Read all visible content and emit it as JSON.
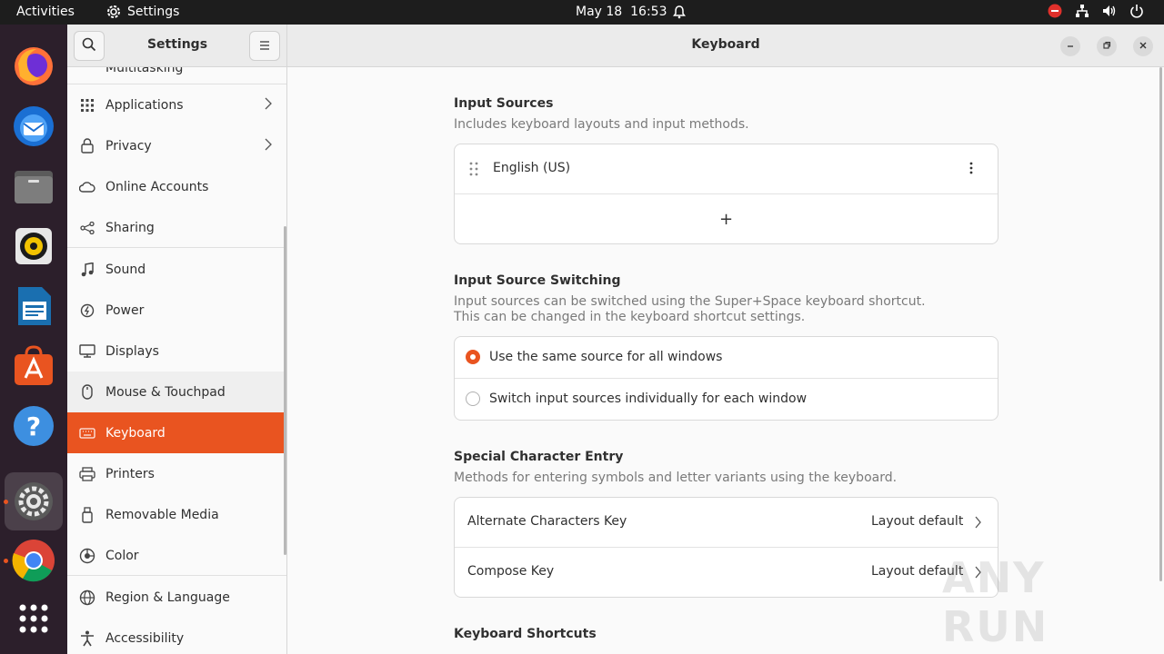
{
  "topbar": {
    "activities": "Activities",
    "app_name": "Settings",
    "date": "May 18",
    "time": "16:53"
  },
  "dock": {
    "items": [
      "firefox-icon",
      "thunderbird-icon",
      "files-icon",
      "rhythmbox-icon",
      "writer-icon",
      "app-center-icon",
      "help-icon",
      "settings-icon",
      "chrome-icon",
      "app-grid-icon"
    ]
  },
  "sidebar": {
    "title": "Settings",
    "partial_top": "Multitasking",
    "items": [
      {
        "label": "Applications",
        "icon": "apps-grid-icon"
      },
      {
        "label": "Privacy",
        "icon": "lock-icon"
      },
      {
        "label": "Online Accounts",
        "icon": "cloud-icon"
      },
      {
        "label": "Sharing",
        "icon": "share-icon"
      },
      {
        "label": "Sound",
        "icon": "music-note-icon"
      },
      {
        "label": "Power",
        "icon": "power-icon"
      },
      {
        "label": "Displays",
        "icon": "display-icon"
      },
      {
        "label": "Mouse & Touchpad",
        "icon": "mouse-icon"
      },
      {
        "label": "Keyboard",
        "icon": "keyboard-icon"
      },
      {
        "label": "Printers",
        "icon": "printer-icon"
      },
      {
        "label": "Removable Media",
        "icon": "usb-icon"
      },
      {
        "label": "Color",
        "icon": "color-icon"
      },
      {
        "label": "Region & Language",
        "icon": "globe-icon"
      },
      {
        "label": "Accessibility",
        "icon": "accessibility-icon"
      }
    ]
  },
  "window": {
    "title": "Keyboard"
  },
  "input_sources": {
    "title": "Input Sources",
    "description": "Includes keyboard layouts and input methods.",
    "sources": [
      "English (US)"
    ],
    "add_symbol": "+"
  },
  "switching": {
    "title": "Input Source Switching",
    "description_1": "Input sources can be switched using the Super+Space keyboard shortcut.",
    "description_2": "This can be changed in the keyboard shortcut settings.",
    "option_same": "Use the same source for all windows",
    "option_individual": "Switch input sources individually for each window",
    "selected": "Use the same source for all windows"
  },
  "special_chars": {
    "title": "Special Character Entry",
    "description": "Methods for entering symbols and letter variants using the keyboard.",
    "rows": [
      {
        "label": "Alternate Characters Key",
        "value": "Layout default"
      },
      {
        "label": "Compose Key",
        "value": "Layout default"
      }
    ]
  },
  "shortcuts": {
    "title": "Keyboard Shortcuts"
  },
  "watermark": "ANY RUN",
  "colors": {
    "accent": "#e95420",
    "dock": "#2c1f2b",
    "topbar": "#1d1d1d"
  }
}
